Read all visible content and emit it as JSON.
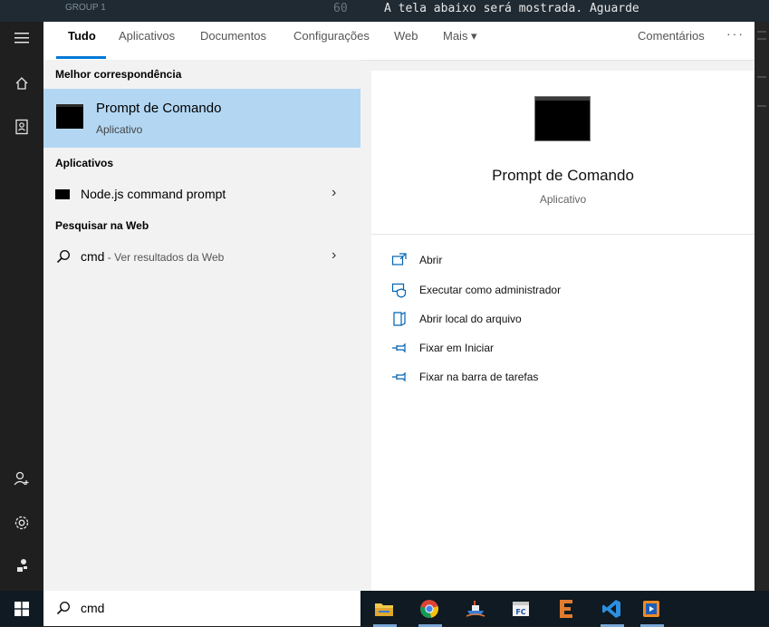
{
  "background_editor": {
    "group_label": "GROUP 1",
    "line_number": "60",
    "code_text": "A tela abaixo será mostrada. Aguarde"
  },
  "tabs": [
    {
      "label": "Tudo",
      "active": true
    },
    {
      "label": "Aplicativos"
    },
    {
      "label": "Documentos"
    },
    {
      "label": "Configurações"
    },
    {
      "label": "Web"
    },
    {
      "label": "Mais ▾"
    }
  ],
  "feedback_label": "Comentários",
  "more_options_label": "···",
  "best_match": {
    "heading": "Melhor correspondência",
    "title": "Prompt de Comando",
    "subtitle": "Aplicativo"
  },
  "apps_section": {
    "heading": "Aplicativos",
    "items": [
      {
        "label": "Node.js command prompt"
      }
    ]
  },
  "web_section": {
    "heading": "Pesquisar na Web",
    "query": "cmd",
    "suffix": " - Ver resultados da Web"
  },
  "detail": {
    "title": "Prompt de Comando",
    "subtitle": "Aplicativo",
    "actions": [
      {
        "label": "Abrir",
        "icon": "open-icon"
      },
      {
        "label": "Executar como administrador",
        "icon": "shield-run-icon"
      },
      {
        "label": "Abrir local do arquivo",
        "icon": "folder-location-icon"
      },
      {
        "label": "Fixar em Iniciar",
        "icon": "pin-icon"
      },
      {
        "label": "Fixar na barra de tarefas",
        "icon": "pin-icon"
      }
    ]
  },
  "taskbar": {
    "search_value": "cmd",
    "apps": [
      "file-explorer-icon",
      "chrome-icon",
      "ship-app-icon",
      "fc-app-icon",
      "e-app-icon",
      "vscode-icon",
      "media-app-icon"
    ]
  },
  "colors": {
    "accent": "#0078d7",
    "selected_row": "#b3d7f3",
    "action_icon": "#0063b1"
  }
}
